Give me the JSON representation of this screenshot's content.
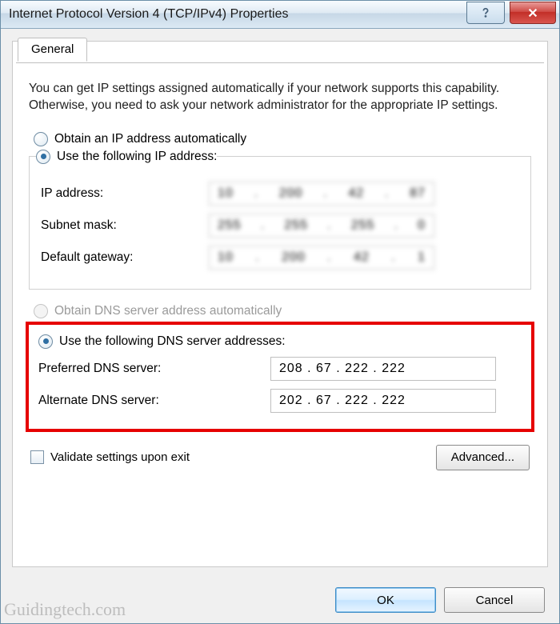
{
  "window": {
    "title": "Internet Protocol Version 4 (TCP/IPv4) Properties"
  },
  "tab": {
    "general": "General"
  },
  "intro": "You can get IP settings assigned automatically if your network supports this capability. Otherwise, you need to ask your network administrator for the appropriate IP settings.",
  "ip": {
    "auto_label": "Obtain an IP address automatically",
    "manual_label": "Use the following IP address:",
    "addr_label": "IP address:",
    "mask_label": "Subnet mask:",
    "gw_label": "Default gateway:"
  },
  "dns": {
    "auto_label": "Obtain DNS server address automatically",
    "manual_label": "Use the following DNS server addresses:",
    "pref_label": "Preferred DNS server:",
    "alt_label": "Alternate DNS server:",
    "pref_value": "208 . 67  . 222 . 222",
    "alt_value": "202 . 67  . 222 . 222"
  },
  "validate_label": "Validate settings upon exit",
  "buttons": {
    "advanced": "Advanced...",
    "ok": "OK",
    "cancel": "Cancel"
  },
  "watermark": "Guidingtech.com"
}
